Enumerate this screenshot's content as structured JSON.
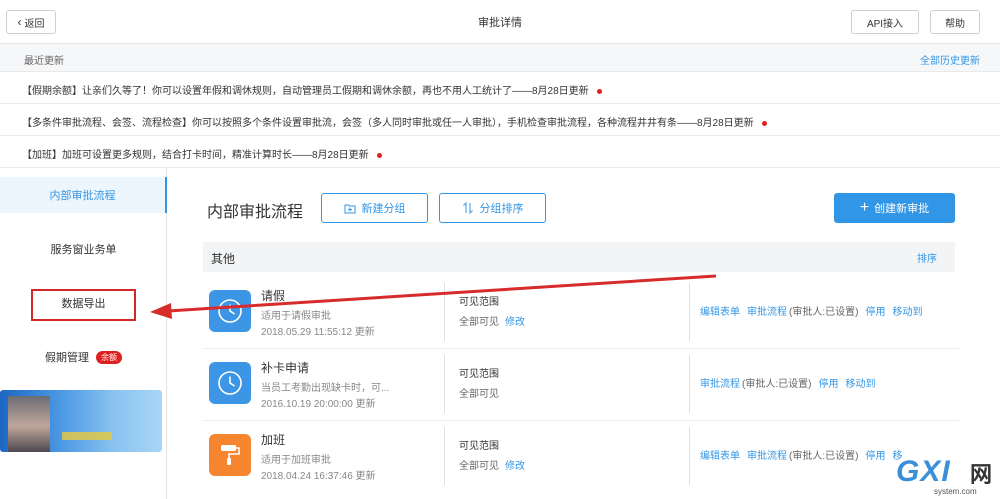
{
  "header": {
    "back_label": "返回",
    "title": "审批详情",
    "api_label": "API接入",
    "help_label": "帮助"
  },
  "updates": {
    "label": "最近更新",
    "history_link": "全部历史更新",
    "items": [
      "【假期余额】让亲们久等了！你可以设置年假和调休规则，自动管理员工假期和调休余额，再也不用人工统计了——8月28日更新",
      "【多条件审批流程、会签、流程检查】你可以按照多个条件设置审批流，会签（多人同时审批或任一人审批），手机检查审批流程，各种流程井井有条——8月28日更新",
      "【加班】加班可设置更多规则，结合打卡时间，精准计算时长——8月28日更新"
    ]
  },
  "sidebar": {
    "items": [
      {
        "label": "内部审批流程"
      },
      {
        "label": "服务窗业务单"
      },
      {
        "label": "数据导出"
      },
      {
        "label": "假期管理",
        "badge": "余额"
      }
    ]
  },
  "main": {
    "title": "内部审批流程",
    "new_group_label": "新建分组",
    "sort_group_label": "分组排序",
    "create_label": "创建新审批",
    "group": {
      "name": "其他",
      "sort_label": "排序"
    },
    "processes": [
      {
        "name": "请假",
        "icon": "clock-icon",
        "desc": "适用于请假审批",
        "time": "2018.05.29 11:55:12 更新",
        "vis_label": "可见范围",
        "vis_value": "全部可见",
        "vis_edit": "修改",
        "actions": [
          "编辑表单",
          "审批流程"
        ],
        "note": "(审批人:已设置)",
        "actions2": [
          "停用",
          "移动到"
        ]
      },
      {
        "name": "补卡申请",
        "icon": "clock-icon",
        "desc": "当员工考勤出现缺卡时，可...",
        "time": "2016.10.19 20:00:00 更新",
        "vis_label": "可见范围",
        "vis_value": "全部可见",
        "vis_edit": "",
        "actions": [
          "审批流程"
        ],
        "note": "(审批人:已设置)",
        "actions2": [
          "停用",
          "移动到"
        ]
      },
      {
        "name": "加班",
        "icon": "paint-roller-icon",
        "desc": "适用于加班审批",
        "time": "2018.04.24 16:37:46 更新",
        "vis_label": "可见范围",
        "vis_value": "全部可见",
        "vis_edit": "修改",
        "actions": [
          "编辑表单",
          "审批流程"
        ],
        "note": "(审批人:已设置)",
        "actions2": [
          "停用",
          "移"
        ]
      }
    ]
  },
  "watermark": {
    "big": "GXI",
    "net": "网",
    "small": "system.com"
  },
  "colors": {
    "accent": "#3296e6",
    "alert": "#d32828",
    "orange": "#f5852f"
  }
}
